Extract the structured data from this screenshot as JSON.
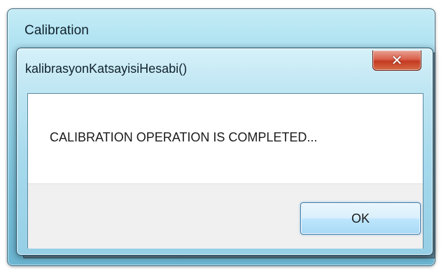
{
  "parent_window": {
    "title": "Calibration"
  },
  "dialog": {
    "title": "kalibrasyonKatsayisiHesabi()",
    "close_icon": "close-icon",
    "message": "CALIBRATION OPERATION IS COMPLETED...",
    "ok_label": "OK"
  },
  "colors": {
    "close_button": "#c43a22",
    "ok_border": "#3c7fb1",
    "glass": "#a9dff0"
  }
}
